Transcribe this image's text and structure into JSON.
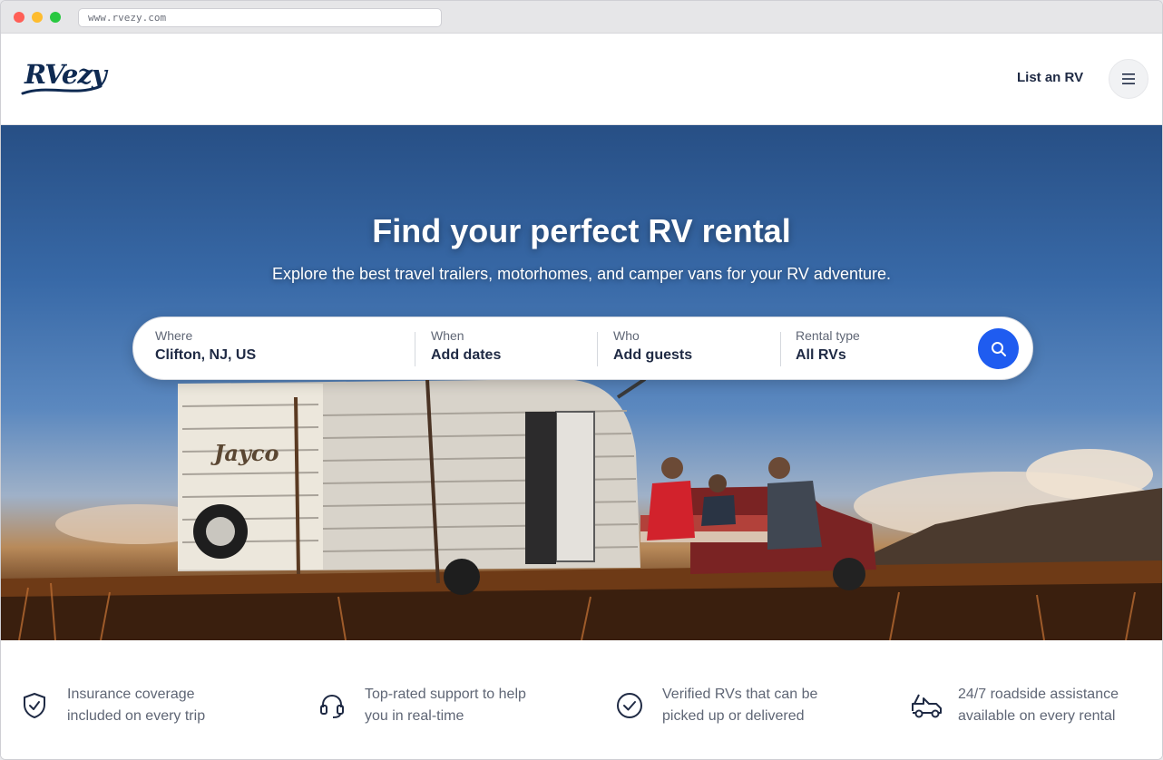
{
  "browser": {
    "url": "www.rvezy.com"
  },
  "header": {
    "logo_text": "RVezy",
    "list_rv_label": "List an RV"
  },
  "hero": {
    "title": "Find your perfect RV rental",
    "subtitle": "Explore the best travel trailers, motorhomes, and camper vans for your RV adventure.",
    "trailer_brand": "Jayco"
  },
  "search": {
    "where": {
      "label": "Where",
      "value": "Clifton, NJ, US"
    },
    "when": {
      "label": "When",
      "value": "Add dates"
    },
    "who": {
      "label": "Who",
      "value": "Add guests"
    },
    "rental_type": {
      "label": "Rental type",
      "value": "All RVs"
    },
    "button_icon": "search-icon"
  },
  "features": [
    {
      "icon": "shield-check-icon",
      "line1": "Insurance coverage",
      "line2": "included on every trip"
    },
    {
      "icon": "headset-icon",
      "line1": "Top-rated support to help",
      "line2": "you in real-time"
    },
    {
      "icon": "check-circle-icon",
      "line1": "Verified RVs that can be",
      "line2": "picked up or delivered"
    },
    {
      "icon": "tow-truck-icon",
      "line1": "24/7 roadside assistance",
      "line2": "available on every rental"
    }
  ],
  "colors": {
    "brand_navy": "#0f2a52",
    "accent_blue": "#1f5cf0"
  }
}
